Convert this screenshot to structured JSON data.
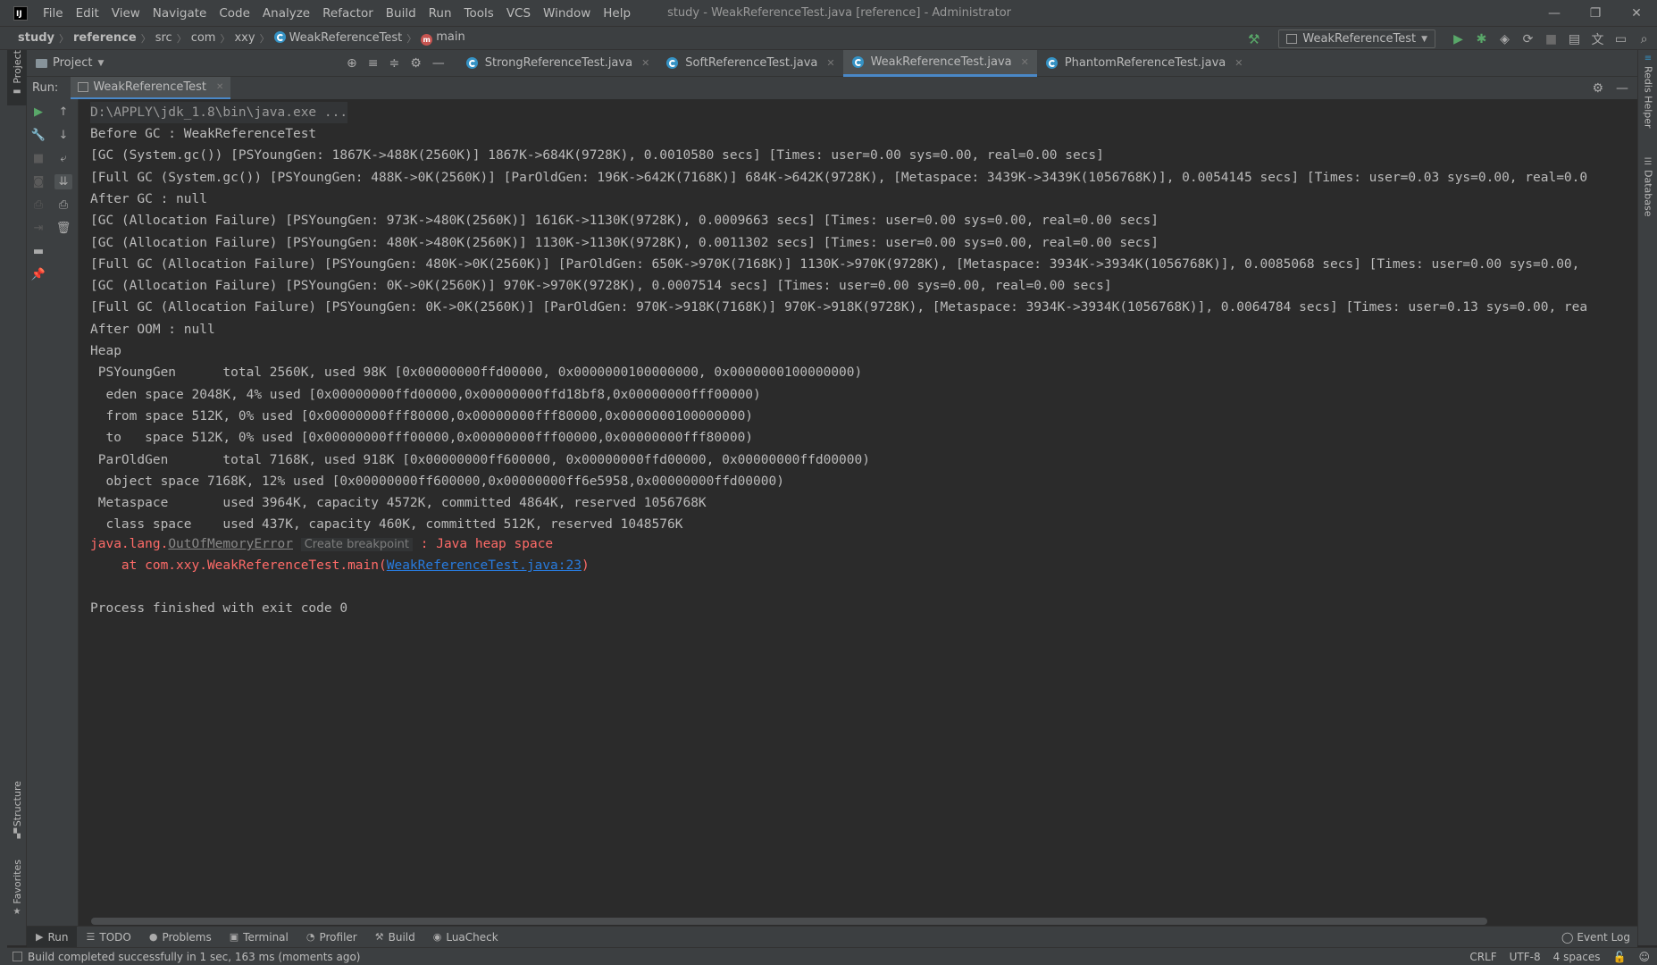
{
  "app": {
    "logo_text": "IJ",
    "window_title": "study - WeakReferenceTest.java [reference] - Administrator"
  },
  "menu": [
    "File",
    "Edit",
    "View",
    "Navigate",
    "Code",
    "Analyze",
    "Refactor",
    "Build",
    "Run",
    "Tools",
    "VCS",
    "Window",
    "Help"
  ],
  "window_controls": {
    "minimize": "—",
    "restore": "❐",
    "close": "✕"
  },
  "breadcrumb": [
    "study",
    "reference",
    "src",
    "com",
    "xxy",
    "WeakReferenceTest",
    "main"
  ],
  "run_config": {
    "selected": "WeakReferenceTest"
  },
  "toolbar_icons": [
    "hammer-icon",
    "run-icon",
    "debug-icon",
    "coverage-icon",
    "profile-icon",
    "stop-icon",
    "project-structure-icon",
    "translate-icon",
    "layout-icon",
    "search-icon"
  ],
  "project_panel": {
    "label": "Project"
  },
  "editor_tabs": [
    {
      "label": "StrongReferenceTest.java",
      "active": false
    },
    {
      "label": "SoftReferenceTest.java",
      "active": false
    },
    {
      "label": "WeakReferenceTest.java",
      "active": true
    },
    {
      "label": "PhantomReferenceTest.java",
      "active": false
    }
  ],
  "run_panel": {
    "label": "Run:",
    "tab": "WeakReferenceTest"
  },
  "left_tool_windows": {
    "project": "Project",
    "structure": "Structure",
    "favorites": "Favorites"
  },
  "right_tool_windows": {
    "redis": "Redis Helper",
    "database": "Database"
  },
  "console": {
    "cmd": "D:\\APPLY\\jdk_1.8\\bin\\java.exe ...",
    "lines": [
      "Before GC : WeakReferenceTest",
      "[GC (System.gc()) [PSYoungGen: 1867K->488K(2560K)] 1867K->684K(9728K), 0.0010580 secs] [Times: user=0.00 sys=0.00, real=0.00 secs]",
      "[Full GC (System.gc()) [PSYoungGen: 488K->0K(2560K)] [ParOldGen: 196K->642K(7168K)] 684K->642K(9728K), [Metaspace: 3439K->3439K(1056768K)], 0.0054145 secs] [Times: user=0.03 sys=0.00, real=0.0",
      "After GC : null",
      "[GC (Allocation Failure) [PSYoungGen: 973K->480K(2560K)] 1616K->1130K(9728K), 0.0009663 secs] [Times: user=0.00 sys=0.00, real=0.00 secs]",
      "[GC (Allocation Failure) [PSYoungGen: 480K->480K(2560K)] 1130K->1130K(9728K), 0.0011302 secs] [Times: user=0.00 sys=0.00, real=0.00 secs]",
      "[Full GC (Allocation Failure) [PSYoungGen: 480K->0K(2560K)] [ParOldGen: 650K->970K(7168K)] 1130K->970K(9728K), [Metaspace: 3934K->3934K(1056768K)], 0.0085068 secs] [Times: user=0.00 sys=0.00,",
      "[GC (Allocation Failure) [PSYoungGen: 0K->0K(2560K)] 970K->970K(9728K), 0.0007514 secs] [Times: user=0.00 sys=0.00, real=0.00 secs]",
      "[Full GC (Allocation Failure) [PSYoungGen: 0K->0K(2560K)] [ParOldGen: 970K->918K(7168K)] 970K->918K(9728K), [Metaspace: 3934K->3934K(1056768K)], 0.0064784 secs] [Times: user=0.13 sys=0.00, rea",
      "After OOM : null",
      "Heap",
      " PSYoungGen      total 2560K, used 98K [0x00000000ffd00000, 0x0000000100000000, 0x0000000100000000)",
      "  eden space 2048K, 4% used [0x00000000ffd00000,0x00000000ffd18bf8,0x00000000fff00000)",
      "  from space 512K, 0% used [0x00000000fff80000,0x00000000fff80000,0x0000000100000000)",
      "  to   space 512K, 0% used [0x00000000fff00000,0x00000000fff00000,0x00000000fff80000)",
      " ParOldGen       total 7168K, used 918K [0x00000000ff600000, 0x00000000ffd00000, 0x00000000ffd00000)",
      "  object space 7168K, 12% used [0x00000000ff600000,0x00000000ff6e5958,0x00000000ffd00000)",
      " Metaspace       used 3964K, capacity 4572K, committed 4864K, reserved 1056768K",
      "  class space    used 437K, capacity 460K, committed 512K, reserved 1048576K"
    ],
    "error": {
      "prefix": "java.lang.",
      "exception": "OutOfMemoryError",
      "create_breakpoint": "Create breakpoint",
      "message": " : Java heap space",
      "at_prefix": "    at com.xxy.WeakReferenceTest.main(",
      "location_link": "WeakReferenceTest.java:23",
      "at_suffix": ")"
    },
    "exit": "Process finished with exit code 0"
  },
  "bottom_tools": [
    {
      "label": "Run",
      "icon": "▶",
      "active": true
    },
    {
      "label": "TODO",
      "icon": "☰",
      "active": false
    },
    {
      "label": "Problems",
      "icon": "●",
      "active": false
    },
    {
      "label": "Terminal",
      "icon": "▣",
      "active": false
    },
    {
      "label": "Profiler",
      "icon": "◔",
      "active": false
    },
    {
      "label": "Build",
      "icon": "⚒",
      "active": false
    },
    {
      "label": "LuaCheck",
      "icon": "◉",
      "active": false
    }
  ],
  "event_log": "Event Log",
  "status": {
    "message": "Build completed successfully in 1 sec, 163 ms (moments ago)",
    "line_sep": "CRLF",
    "encoding": "UTF-8",
    "indent": "4 spaces"
  }
}
